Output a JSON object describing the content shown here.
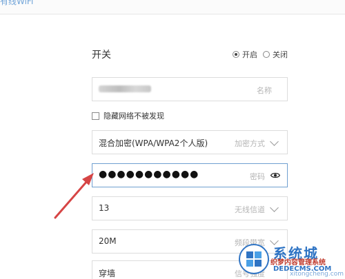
{
  "header": {
    "title": "有线WiFi"
  },
  "switch": {
    "label": "开关",
    "options": [
      {
        "label": "开启",
        "selected": true
      },
      {
        "label": "关闭",
        "selected": false
      }
    ]
  },
  "ssid": {
    "label": "名称"
  },
  "hidden_network": {
    "label": "隐藏网络不被发现",
    "checked": false
  },
  "encryption": {
    "value": "混合加密(WPA/WPA2个人版)",
    "label": "加密方式"
  },
  "password": {
    "masked_value": "●●●●●●●●●●●",
    "label": "密码"
  },
  "channel": {
    "value": "13",
    "label": "无线信道"
  },
  "bandwidth": {
    "value": "20M",
    "label": "频段带宽"
  },
  "signal": {
    "value": "穿墙",
    "label": "信号强度"
  },
  "watermark": {
    "title": "系统城",
    "subtitle": "织梦内容管理系统",
    "url": "DEDECMS.COM",
    "pinyin": "xitongcheng.com"
  },
  "colors": {
    "accent": "#6f9fd0",
    "arrow": "#d64545",
    "border": "#dcdcdc",
    "label_gray": "#b5b5b5"
  }
}
